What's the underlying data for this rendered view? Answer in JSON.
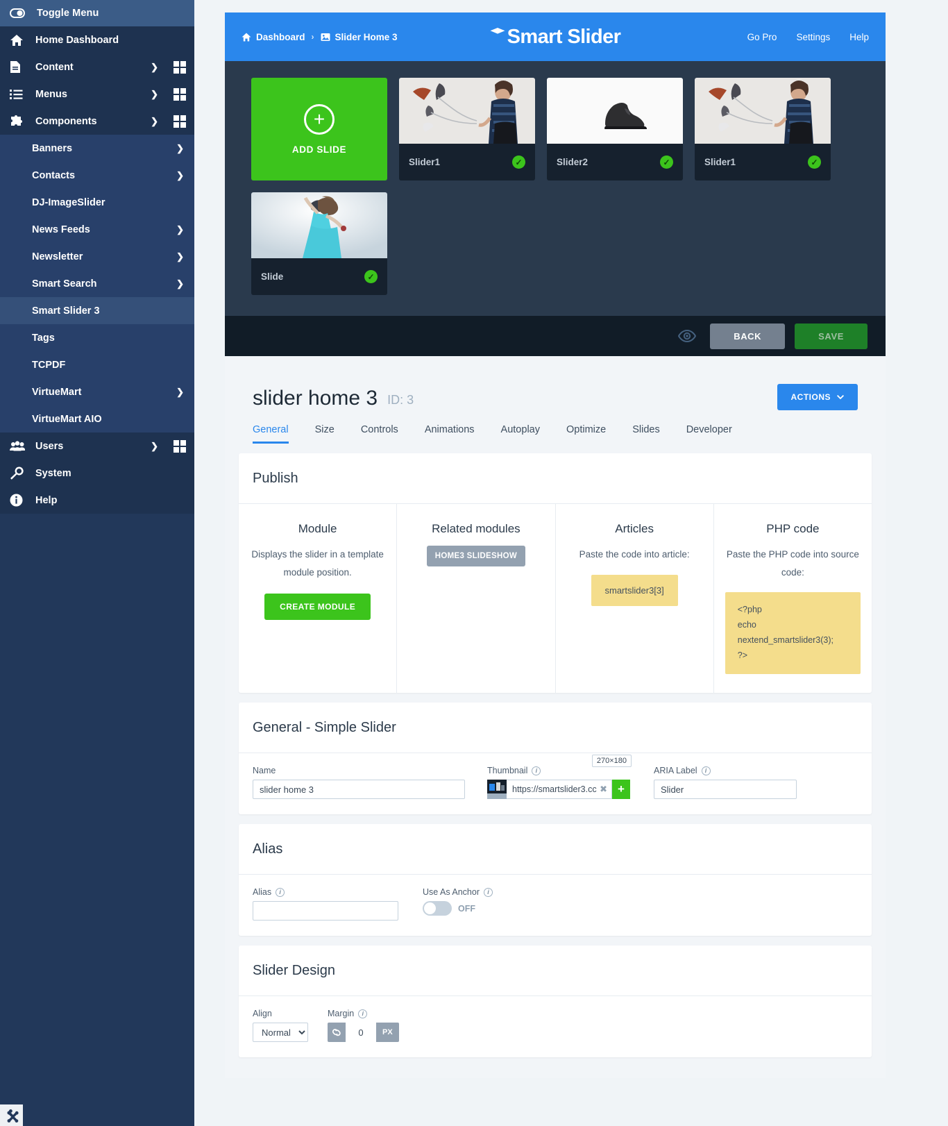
{
  "sidebar": {
    "toggle": {
      "label": "Toggle Menu",
      "icon": "toggle-icon"
    },
    "top_items": [
      {
        "label": "Home Dashboard",
        "icon": "home-icon",
        "chevron": false,
        "grid": false
      },
      {
        "label": "Content",
        "icon": "document-icon",
        "chevron": true,
        "grid": true
      },
      {
        "label": "Menus",
        "icon": "list-icon",
        "chevron": true,
        "grid": true
      },
      {
        "label": "Components",
        "icon": "puzzle-icon",
        "chevron": "down",
        "grid": true
      }
    ],
    "sub_items": [
      {
        "label": "Banners",
        "chevron": true,
        "active": false
      },
      {
        "label": "Contacts",
        "chevron": true,
        "active": false
      },
      {
        "label": "DJ-ImageSlider",
        "chevron": false,
        "active": false
      },
      {
        "label": "News Feeds",
        "chevron": true,
        "active": false
      },
      {
        "label": "Newsletter",
        "chevron": true,
        "active": false
      },
      {
        "label": "Smart Search",
        "chevron": true,
        "active": false
      },
      {
        "label": "Smart Slider 3",
        "chevron": false,
        "active": true
      },
      {
        "label": "Tags",
        "chevron": false,
        "active": false
      },
      {
        "label": "TCPDF",
        "chevron": false,
        "active": false
      },
      {
        "label": "VirtueMart",
        "chevron": true,
        "active": false
      },
      {
        "label": "VirtueMart AIO",
        "chevron": false,
        "active": false
      }
    ],
    "bottom_items": [
      {
        "label": "Users",
        "icon": "users-icon",
        "chevron": true,
        "grid": true
      },
      {
        "label": "System",
        "icon": "wrench-icon",
        "chevron": false,
        "grid": false
      },
      {
        "label": "Help",
        "icon": "info-icon",
        "chevron": false,
        "grid": false
      }
    ],
    "joomla_badge": "joomla-logo-icon"
  },
  "header": {
    "breadcrumb": {
      "home": "Dashboard",
      "separator": "›",
      "current": "Slider Home 3"
    },
    "logo": "Smart Slider",
    "nav": [
      {
        "label": "Go Pro"
      },
      {
        "label": "Settings"
      },
      {
        "label": "Help"
      }
    ],
    "accent_color": "#2a87ec"
  },
  "slides": {
    "add_slide_label": "ADD SLIDE",
    "items": [
      {
        "name": "Slider1",
        "published": true,
        "image": "fashion-shoes-woman"
      },
      {
        "name": "Slider2",
        "published": true,
        "image": "black-boot"
      },
      {
        "name": "Slider1",
        "published": true,
        "image": "fashion-shoes-woman"
      },
      {
        "name": "Slide",
        "published": true,
        "image": "woman-turquoise-dress"
      }
    ]
  },
  "action_bar": {
    "preview_icon": "eye-icon",
    "back_label": "BACK",
    "save_label": "SAVE"
  },
  "page": {
    "title": "slider home 3",
    "id_label": "ID: 3",
    "actions_label": "ACTIONS",
    "actions_caret": "chevron-down-icon",
    "tabs": [
      {
        "label": "General",
        "active": true
      },
      {
        "label": "Size",
        "active": false
      },
      {
        "label": "Controls",
        "active": false
      },
      {
        "label": "Animations",
        "active": false
      },
      {
        "label": "Autoplay",
        "active": false
      },
      {
        "label": "Optimize",
        "active": false
      },
      {
        "label": "Slides",
        "active": false
      },
      {
        "label": "Developer",
        "active": false
      }
    ]
  },
  "publish": {
    "heading": "Publish",
    "columns": [
      {
        "title": "Module",
        "desc": "Displays the slider in a template module position.",
        "button": "CREATE MODULE"
      },
      {
        "title": "Related modules",
        "chip": "HOME3 SLIDESHOW"
      },
      {
        "title": "Articles",
        "desc": "Paste the code into article:",
        "code": "smartslider3[3]"
      },
      {
        "title": "PHP code",
        "desc": "Paste the PHP code into source code:",
        "code": "<?php\necho\nnextend_smartslider3(3);\n?>"
      }
    ]
  },
  "general_section": {
    "heading": "General - Simple Slider",
    "name_label": "Name",
    "name_value": "slider home 3",
    "thumbnail_label": "Thumbnail",
    "thumbnail_size": "270×180",
    "thumbnail_value": "https://smartslider3.cc",
    "thumbnail_clear_icon": "clear-x-icon",
    "thumbnail_add_icon": "plus-icon",
    "aria_label": "ARIA Label",
    "aria_value": "Slider"
  },
  "alias_section": {
    "heading": "Alias",
    "alias_label": "Alias",
    "alias_value": "",
    "anchor_label": "Use As Anchor",
    "anchor_state": "OFF"
  },
  "design_section": {
    "heading": "Slider Design",
    "align_label": "Align",
    "align_value": "Normal",
    "align_options": [
      "Normal"
    ],
    "margin_label": "Margin",
    "margin_link_icon": "link-icon",
    "margin_value": "0",
    "margin_unit": "PX"
  }
}
